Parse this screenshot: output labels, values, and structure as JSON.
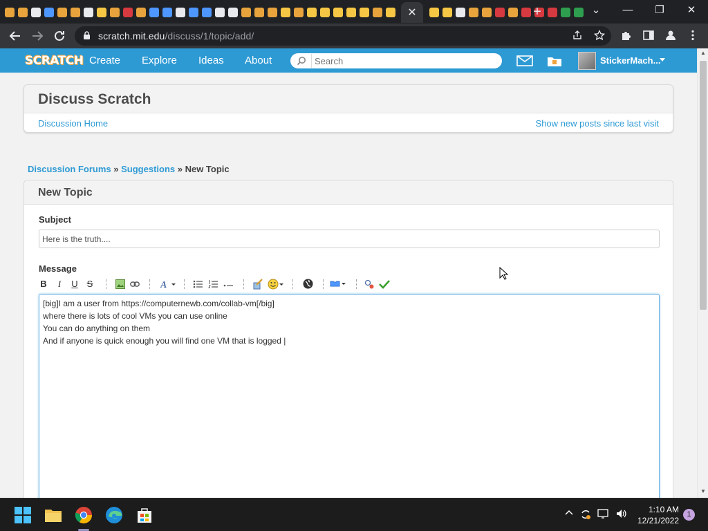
{
  "browser": {
    "url_host": "scratch.mit.edu",
    "url_path": "/discuss/1/topic/add/",
    "active_tab_close": "✕",
    "new_tab": "+",
    "window_controls": {
      "dropdown": "⌄",
      "minimize": "—",
      "restore": "❐",
      "close": "✕"
    }
  },
  "scratch_nav": {
    "logo": "SCRATCH",
    "links": [
      "Create",
      "Explore",
      "Ideas",
      "About"
    ],
    "search_placeholder": "Search",
    "username": "StickerMach..."
  },
  "header": {
    "title": "Discuss Scratch",
    "home_link": "Discussion Home",
    "new_posts_link": "Show new posts since last visit"
  },
  "breadcrumb": {
    "forums": "Discussion Forums",
    "sep1": " » ",
    "category": "Suggestions",
    "sep2": " » ",
    "current": "New Topic"
  },
  "form": {
    "title": "New Topic",
    "subject_label": "Subject",
    "subject_value": "Here is the truth....",
    "message_label": "Message",
    "message_text": "[big]I am a user from https://computernewb.com/collab-vm[/big]\nwhere there is lots of cool VMs you can use online\nYou can do anything on them\nAnd if anyone is quick enough you will find one VM that is logged |",
    "toolbar": {
      "bold": "B",
      "italic": "I",
      "underline": "U",
      "strike": "S"
    }
  },
  "taskbar": {
    "time": "1:10 AM",
    "date": "12/21/2022",
    "notifications": "1"
  },
  "colors": {
    "scratch_blue": "#2e9ad4",
    "chrome_dark": "#202124",
    "chrome_toolbar": "#35363a"
  }
}
